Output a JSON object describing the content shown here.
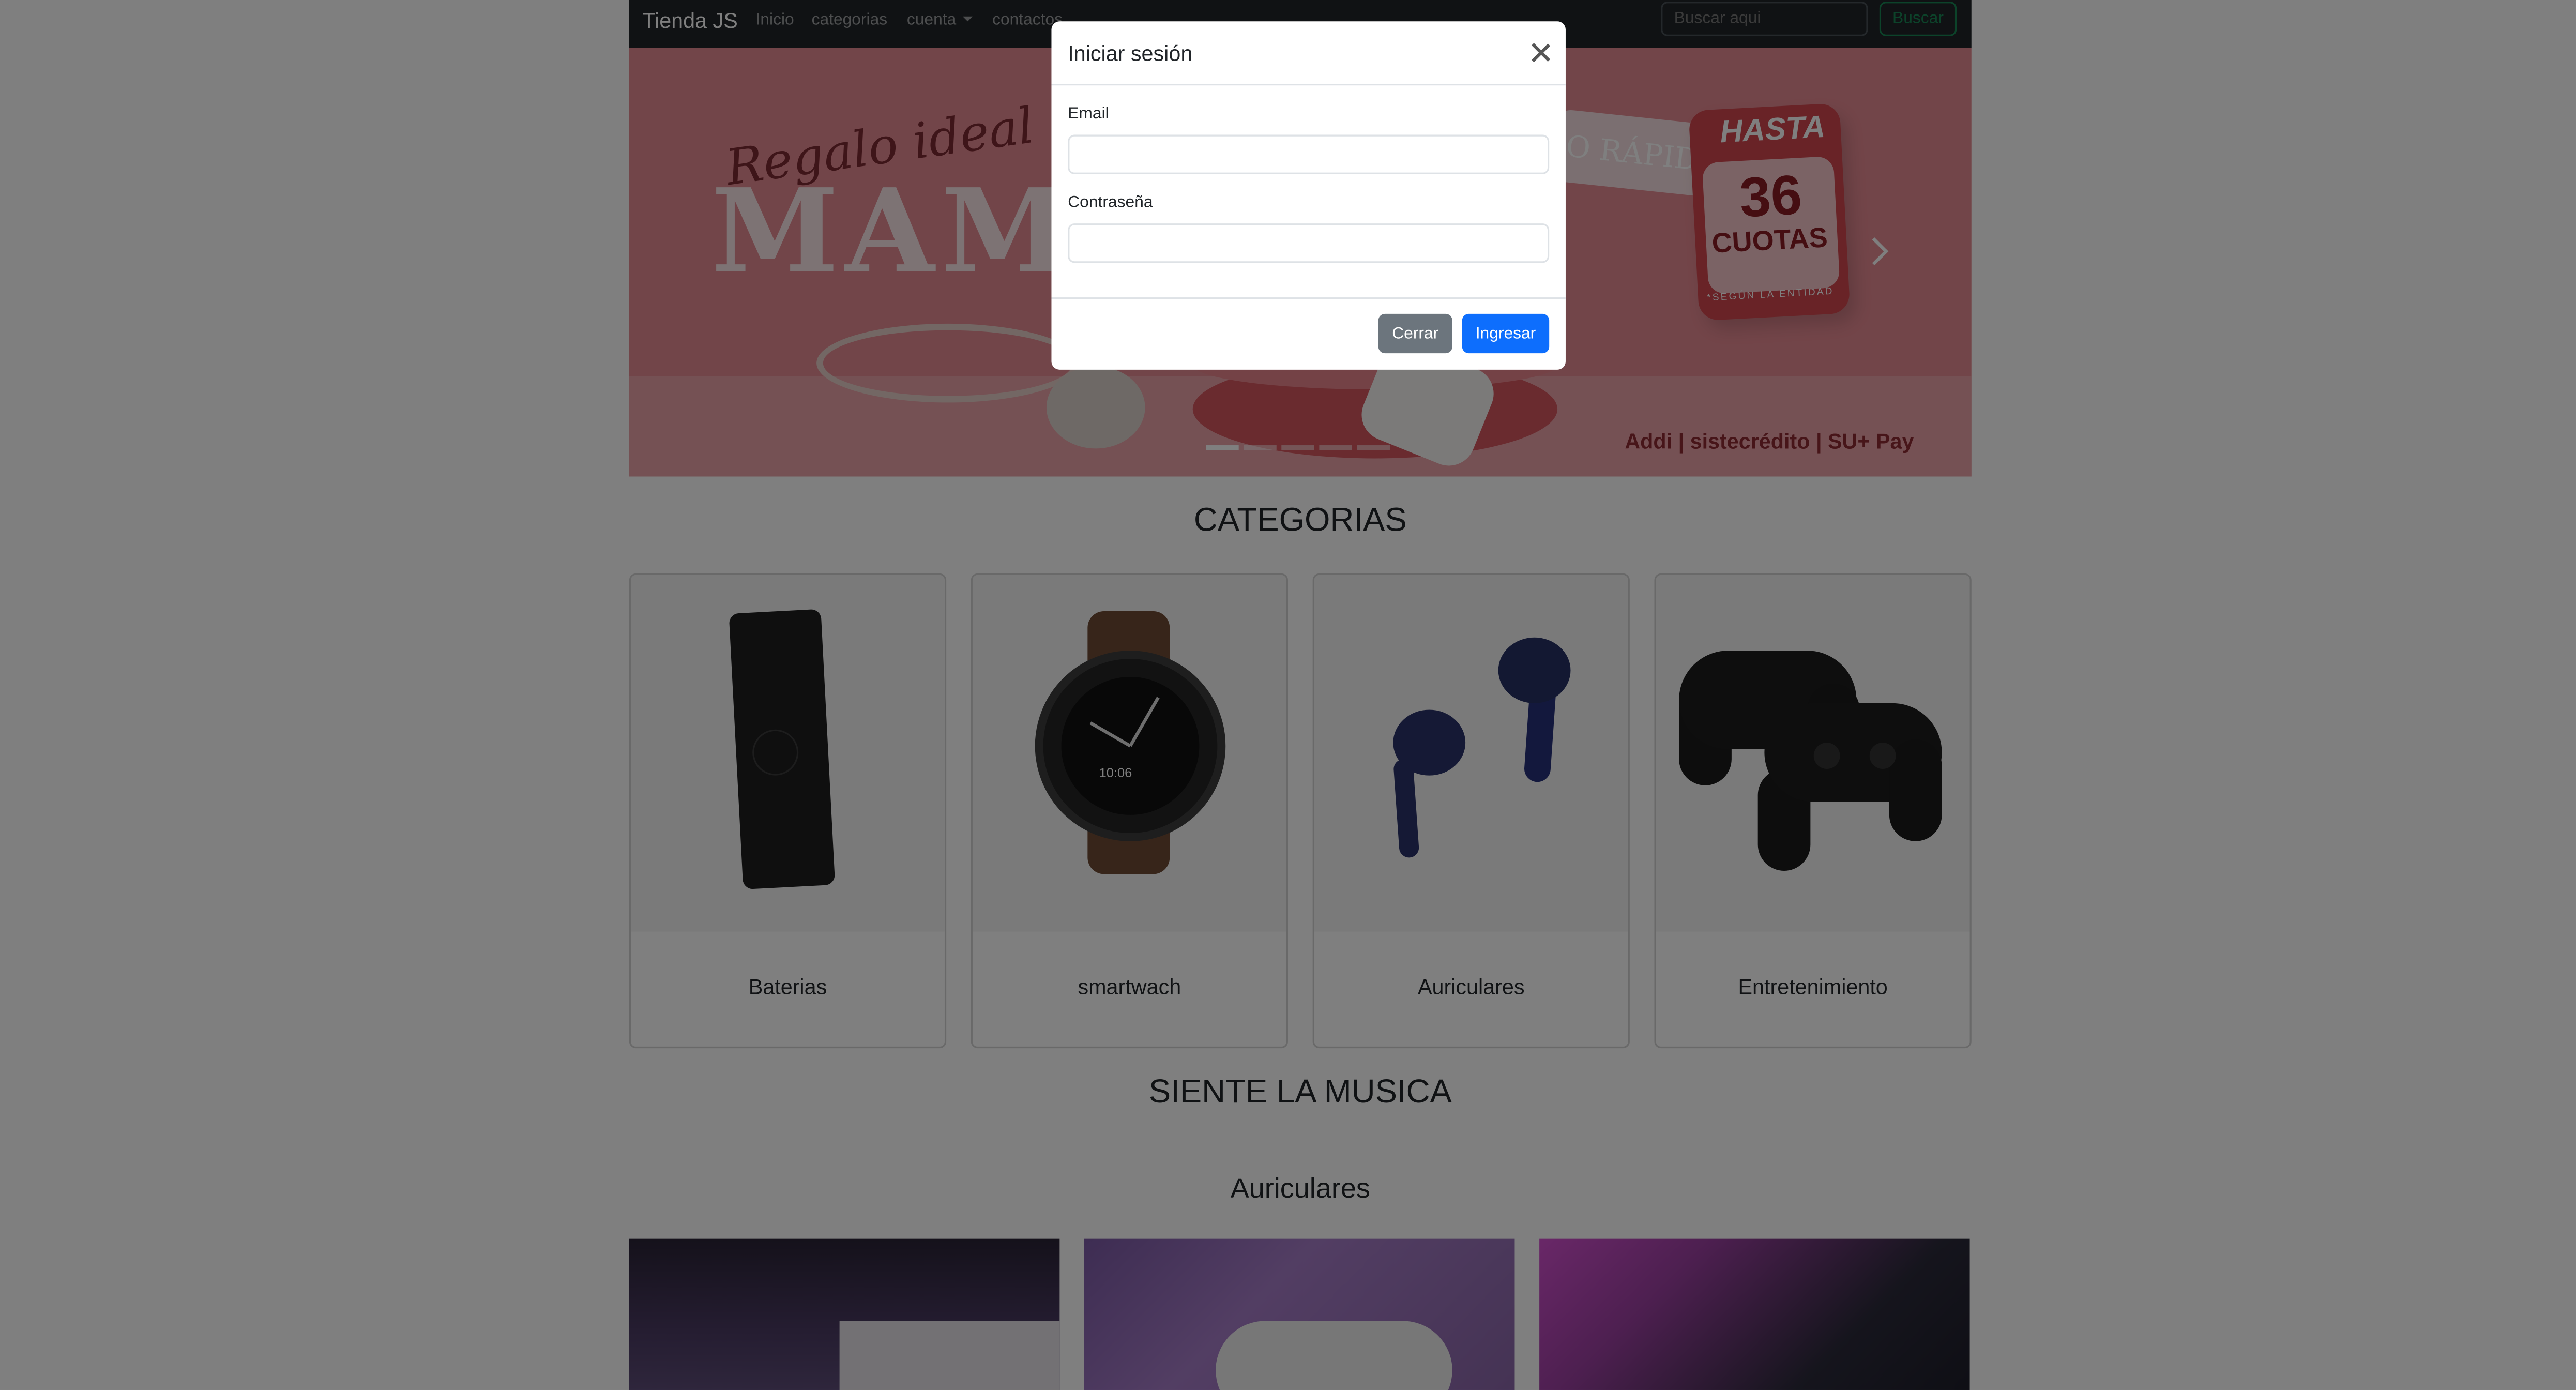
{
  "navbar": {
    "brand": "Tienda JS",
    "links": [
      "Inicio",
      "categorias",
      "cuenta",
      "contactos"
    ],
    "search_placeholder": "Buscar aqui",
    "search_button": "Buscar"
  },
  "carousel": {
    "slide_count": 5,
    "active_index": 0,
    "banner": {
      "script": "Regalo ideal para",
      "headline": "MAMÁ",
      "ribbon": "O RÁPIDO",
      "badge_top": "HASTA",
      "badge_number": "36",
      "badge_sub": "CUOTAS",
      "badge_fine": "*SEGÚN LA ENTIDAD",
      "payments": "Addi | sistecrédito | SU+ Pay"
    }
  },
  "categories": {
    "title": "CATEGORIAS",
    "items": [
      {
        "label": "Baterias",
        "icon": "power-bank-image"
      },
      {
        "label": "smartwach",
        "icon": "smartwatch-image",
        "watch_time": "10:06"
      },
      {
        "label": "Auriculares",
        "icon": "earbuds-image"
      },
      {
        "label": "Entretenimiento",
        "icon": "gamepad-image"
      }
    ]
  },
  "music": {
    "title": "SIENTE LA MUSICA",
    "subtitle": "Auriculares"
  },
  "modal": {
    "title": "Iniciar sesión",
    "email_label": "Email",
    "email_value": "",
    "password_label": "Contraseña",
    "password_value": "",
    "close_button": "Cerrar",
    "submit_button": "Ingresar"
  },
  "colors": {
    "navbar": "#212529",
    "primary": "#0d6efd",
    "secondary": "#6c757d",
    "success": "#198754",
    "banner": "#e58a92"
  }
}
